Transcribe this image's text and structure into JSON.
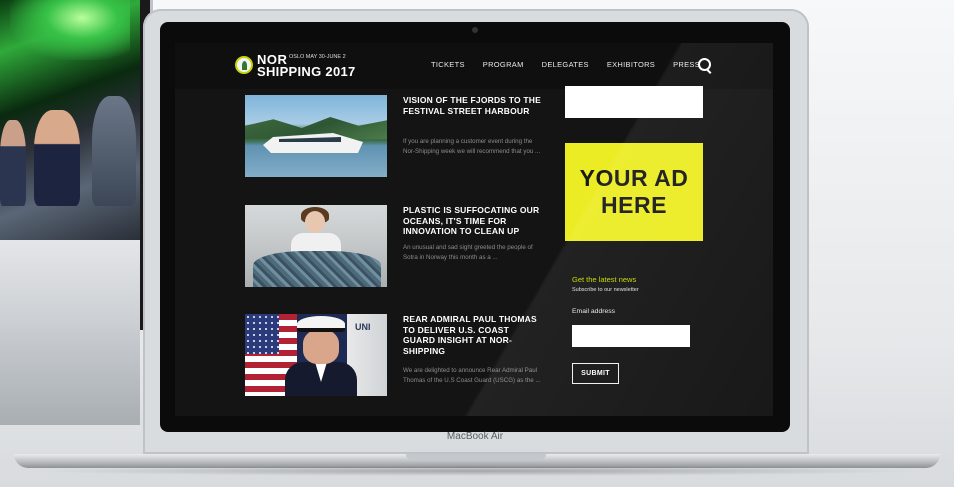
{
  "site": {
    "logo_top": "NOR",
    "logo_meta": "OSLO MAY 30-JUNE 2",
    "logo_bottom": "SHIPPING 2017",
    "nav": [
      "TICKETS",
      "PROGRAM",
      "DELEGATES",
      "EXHIBITORS",
      "PRESS"
    ],
    "search_icon": "search-icon"
  },
  "articles": [
    {
      "title": "VISION OF THE FJORDS TO THE FESTIVAL STREET HARBOUR",
      "excerpt": "If you are planning a customer event during the Nor-Shipping week we will recommend that you ..."
    },
    {
      "title": "PLASTIC IS SUFFOCATING OUR OCEANS, IT'S TIME FOR INNOVATION TO CLEAN UP",
      "excerpt": "An unusual and sad sight greeted the people of Sotra in Norway this month as a ..."
    },
    {
      "title": "REAR ADMIRAL PAUL THOMAS TO DELIVER U.S. COAST GUARD INSIGHT AT NOR-SHIPPING",
      "excerpt": "We are delighted to announce Rear Admiral Paul Thomas of the U.S Coast Guard (USCG) as the ..."
    }
  ],
  "ad": {
    "line1": "YOUR AD",
    "line2": "HERE",
    "color": "#ecec24"
  },
  "newsletter": {
    "title": "Get the latest news",
    "subtitle": "Subscribe to our newsletter",
    "email_label": "Email address",
    "email_value": "",
    "submit_label": "SUBMIT",
    "accent": "#c8d400"
  },
  "device": {
    "label": "MacBook Air"
  },
  "imac": {
    "logo_glyph": ""
  }
}
